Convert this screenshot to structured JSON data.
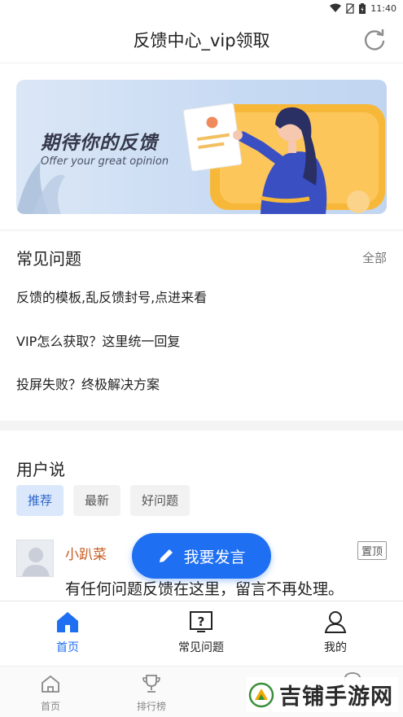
{
  "status_bar": {
    "time": "11:40"
  },
  "header": {
    "title": "反馈中心_vip领取"
  },
  "banner": {
    "title": "期待你的反馈",
    "subtitle": "Offer your great opinion"
  },
  "faq": {
    "heading": "常见问题",
    "all_label": "全部",
    "items": [
      "反馈的模板,乱反馈封号,点进来看",
      "VIP怎么获取？这里统一回复",
      "投屏失败？终极解决方案"
    ]
  },
  "users": {
    "heading": "用户说",
    "tags": [
      "推荐",
      "最新",
      "好问题"
    ],
    "post": {
      "username": "小趴菜",
      "pin_label": "置顶",
      "content": "有任何问题反馈在这里，留言不再处理。"
    }
  },
  "fab": {
    "label": "我要发言"
  },
  "tabbar": {
    "items": [
      "首页",
      "常见问题",
      "我的"
    ],
    "active_index": 0
  },
  "bottom_nav": {
    "items": [
      "首页",
      "排行榜"
    ]
  },
  "watermark": {
    "text": "吉铺手游网"
  },
  "colors": {
    "accent": "#1f6ff2",
    "username": "#c85a1e",
    "fab": "#1f6ff2"
  }
}
